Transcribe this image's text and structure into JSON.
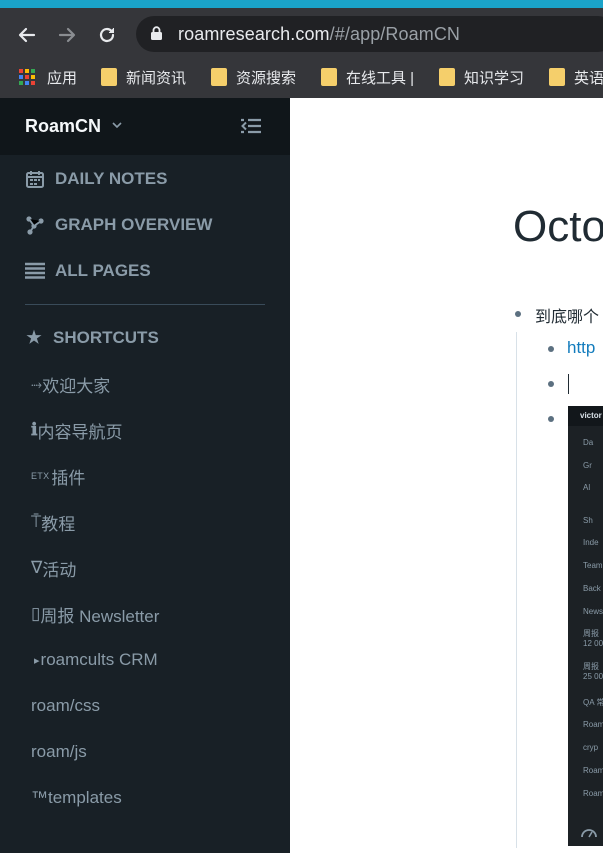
{
  "browser": {
    "url_host": "roamresearch.com",
    "url_path": "/#/app/RoamCN",
    "bookmarks": [
      {
        "label": "应用",
        "icon": "apps-grid-icon"
      },
      {
        "label": "新闻资讯",
        "icon": "folder-icon"
      },
      {
        "label": "资源搜索",
        "icon": "folder-icon"
      },
      {
        "label": "在线工具 |",
        "icon": "folder-icon"
      },
      {
        "label": "知识学习",
        "icon": "folder-icon"
      },
      {
        "label": "英语",
        "icon": "folder-icon"
      }
    ]
  },
  "sidebar": {
    "graph_name": "RoamCN",
    "nav": [
      {
        "label": "DAILY NOTES",
        "icon": "calendar-icon"
      },
      {
        "label": "GRAPH OVERVIEW",
        "icon": "graph-icon"
      },
      {
        "label": "ALL PAGES",
        "icon": "list-icon"
      }
    ],
    "shortcuts_label": "SHORTCUTS",
    "shortcuts": [
      {
        "prefix": "⤑",
        "label": "欢迎大家"
      },
      {
        "prefix": "ℹ",
        "label": "内容导航页"
      },
      {
        "prefix": "ETX",
        "label": "插件"
      },
      {
        "prefix": "⍑",
        "label": "教程"
      },
      {
        "prefix": "∇",
        "label": "活动"
      },
      {
        "prefix": "▯",
        "label": " 周报 Newsletter"
      },
      {
        "prefix": "▸",
        "label": " roamcults CRM"
      },
      {
        "prefix": "",
        "label": "roam/css"
      },
      {
        "prefix": "",
        "label": "roam/js"
      },
      {
        "prefix": "™",
        "label": " templates"
      }
    ]
  },
  "main": {
    "title": "Octo",
    "blocks": [
      {
        "text": "到底哪个"
      },
      {
        "text": "http"
      },
      {
        "text": ""
      }
    ],
    "embedded_screenshot": {
      "header": "victor",
      "items": [
        "Da",
        "Gr",
        "Al",
        "Sh",
        "Inde",
        "Team",
        "Back",
        "News",
        "周报",
        "12 00",
        "周报",
        "25 00",
        "QA 常",
        "Roam",
        "cryp",
        "Roam",
        "Roam"
      ]
    }
  },
  "colors": {
    "sidebar_bg": "#182026",
    "sidebar_header_bg": "#10161a",
    "sidebar_text": "#8a9ba8",
    "link": "#137cbd",
    "browser_chrome": "#35363a",
    "accent_strip": "#1aa3c9"
  }
}
